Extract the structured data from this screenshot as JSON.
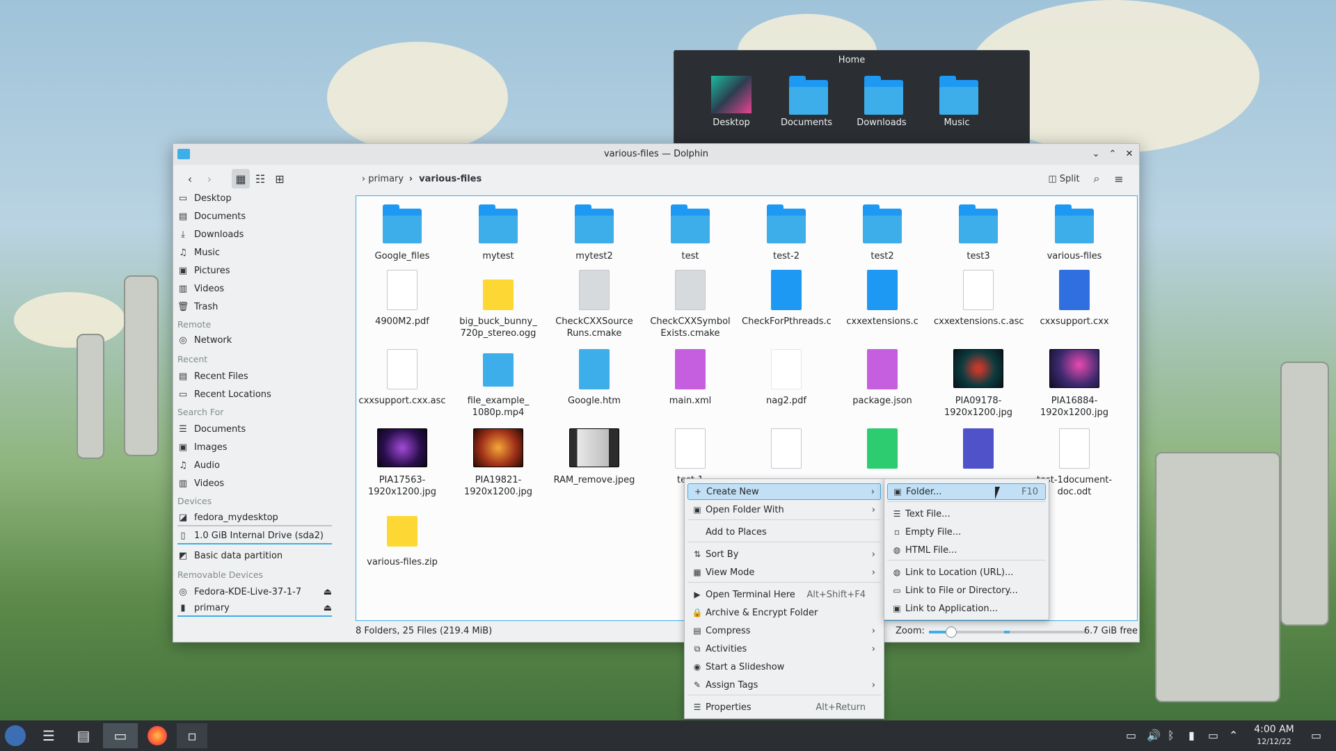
{
  "home_popup": {
    "title": "Home",
    "items": [
      {
        "label": "Desktop"
      },
      {
        "label": "Documents"
      },
      {
        "label": "Downloads"
      },
      {
        "label": "Music"
      }
    ]
  },
  "window": {
    "title": "various-files — Dolphin"
  },
  "toolbar": {
    "breadcrumb": [
      "primary",
      "various-files"
    ],
    "split_label": "Split"
  },
  "sidebar": {
    "places": [
      "Desktop",
      "Documents",
      "Downloads",
      "Music",
      "Pictures",
      "Videos",
      "Trash"
    ],
    "remote_title": "Remote",
    "remote": [
      "Network"
    ],
    "recent_title": "Recent",
    "recent": [
      "Recent Files",
      "Recent Locations"
    ],
    "search_title": "Search For",
    "search": [
      "Documents",
      "Images",
      "Audio",
      "Videos"
    ],
    "devices_title": "Devices",
    "devices": [
      "fedora_mydesktop",
      "1.0 GiB Internal Drive (sda2)",
      "Basic data partition"
    ],
    "removable_title": "Removable Devices",
    "removable": [
      "Fedora-KDE-Live-37-1-7",
      "primary"
    ]
  },
  "files": [
    {
      "name": "Google_files",
      "kind": "folder"
    },
    {
      "name": "mytest",
      "kind": "folder"
    },
    {
      "name": "mytest2",
      "kind": "folder"
    },
    {
      "name": "test",
      "kind": "folder"
    },
    {
      "name": "test-2",
      "kind": "folder"
    },
    {
      "name": "test2",
      "kind": "folder"
    },
    {
      "name": "test3",
      "kind": "folder"
    },
    {
      "name": "various-files",
      "kind": "folder"
    },
    {
      "name": "4900M2.pdf",
      "kind": "pdf"
    },
    {
      "name": "big_buck_bunny_\n720p_stereo.ogg",
      "kind": "audio"
    },
    {
      "name": "CheckCXXSource\nRuns.cmake",
      "kind": "cmake"
    },
    {
      "name": "CheckCXXSymbol\nExists.cmake",
      "kind": "cmake"
    },
    {
      "name": "CheckForPthreads.c",
      "kind": "c"
    },
    {
      "name": "cxxextensions.c",
      "kind": "c"
    },
    {
      "name": "cxxextensions.c.asc",
      "kind": "text"
    },
    {
      "name": "cxxsupport.cxx",
      "kind": "cpp"
    },
    {
      "name": "cxxsupport.cxx.asc",
      "kind": "text"
    },
    {
      "name": "file_example_\n1080p.mp4",
      "kind": "video"
    },
    {
      "name": "Google.htm",
      "kind": "html"
    },
    {
      "name": "main.xml",
      "kind": "xml"
    },
    {
      "name": "nag2.pdf",
      "kind": "pdf2"
    },
    {
      "name": "package.json",
      "kind": "json"
    },
    {
      "name": "PIA09178-\n1920x1200.jpg",
      "kind": "img1"
    },
    {
      "name": "PIA16884-\n1920x1200.jpg",
      "kind": "img2"
    },
    {
      "name": "PIA17563-\n1920x1200.jpg",
      "kind": "img3"
    },
    {
      "name": "PIA19821-\n1920x1200.jpg",
      "kind": "img4"
    },
    {
      "name": "RAM_remove.jpeg",
      "kind": "img5"
    },
    {
      "name": "test-1",
      "kind": "doc"
    },
    {
      "name": "",
      "kind": "doc"
    },
    {
      "name": "",
      "kind": "sheet"
    },
    {
      "name": "",
      "kind": "writer"
    },
    {
      "name": "test-1document-\ndoc.odt",
      "kind": "doc"
    },
    {
      "name": "various-files.zip",
      "kind": "zip"
    }
  ],
  "status": {
    "summary": "8 Folders, 25 Files (219.4 MiB)",
    "zoom_label": "Zoom:",
    "free": "6.7 GiB free"
  },
  "context_menu": [
    {
      "label": "Create New",
      "icon": "plus-icon",
      "sub": true
    },
    {
      "label": "Open Folder With",
      "icon": "folder-icon",
      "sub": true
    },
    {
      "label": "Add to Places",
      "icon": "",
      "sub": false
    },
    {
      "label": "Sort By",
      "icon": "sort-icon",
      "sub": true
    },
    {
      "label": "View Mode",
      "icon": "grid-icon",
      "sub": true
    },
    {
      "label": "Open Terminal Here",
      "icon": "terminal-icon",
      "shortcut": "Alt+Shift+F4"
    },
    {
      "label": "Archive & Encrypt Folder",
      "icon": "lock-icon"
    },
    {
      "label": "Compress",
      "icon": "archive-icon",
      "sub": true
    },
    {
      "label": "Activities",
      "icon": "activities-icon",
      "sub": true
    },
    {
      "label": "Start a Slideshow",
      "icon": "slideshow-icon"
    },
    {
      "label": "Assign Tags",
      "icon": "tag-icon",
      "sub": true
    },
    {
      "label": "Properties",
      "icon": "properties-icon",
      "shortcut": "Alt+Return"
    }
  ],
  "create_new_menu": [
    {
      "label": "Folder...",
      "shortcut": "F10"
    },
    {
      "label": "Text File..."
    },
    {
      "label": "Empty File..."
    },
    {
      "label": "HTML File..."
    },
    {
      "label": "Link to Location (URL)..."
    },
    {
      "label": "Link to File or Directory..."
    },
    {
      "label": "Link to Application..."
    }
  ],
  "clock": {
    "time": "4:00 AM",
    "date": "12/12/22"
  }
}
